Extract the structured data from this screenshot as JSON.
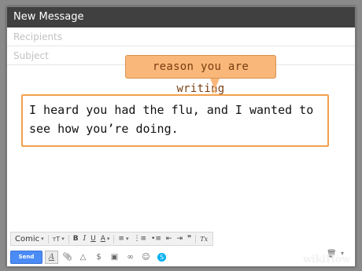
{
  "window": {
    "title": "New Message"
  },
  "fields": {
    "recipients_placeholder": "Recipients",
    "subject_placeholder": "Subject"
  },
  "callout": {
    "label": "reason you are writing"
  },
  "message": {
    "body": "I heard you had the flu, and I wanted to see how you’re doing."
  },
  "format_bar": {
    "font_name": "Comic",
    "size_icon": "text-size-icon",
    "bold": "B",
    "italic": "I",
    "underline": "U",
    "text_color": "A",
    "quote": "❞",
    "clear": "Tx"
  },
  "bottom_bar": {
    "send_label": "Send"
  },
  "watermark": "wikiHow",
  "colors": {
    "titlebar": "#404040",
    "callout": "#f9b77a",
    "highlight_border": "#f3a14d",
    "send_button": "#4a8bf5"
  }
}
